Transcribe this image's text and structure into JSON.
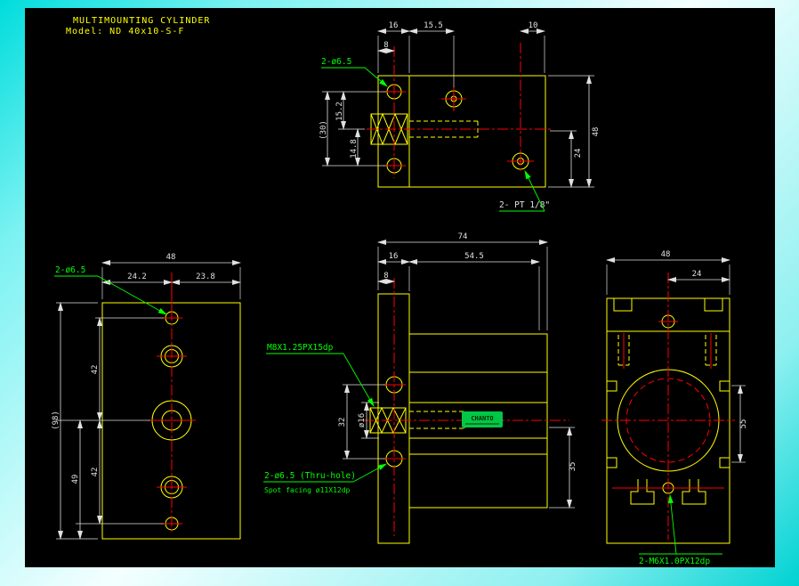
{
  "title": {
    "line1": "MULTIMOUNTING CYLINDER",
    "line2": "Model: ND 40x10-S-F"
  },
  "colors": {
    "canvas_background": "#000000",
    "geometry": "#ffff00",
    "centerline": "#ff0000",
    "dimension": "#e0e0e0",
    "annotation": "#00ff00",
    "title_text": "#ffff00",
    "logo_fill": "#00c846",
    "frame_cyan": "#00dcdc",
    "frame_white": "#f4ffff"
  },
  "top_view": {
    "dim_16": "16",
    "dim_15_5": "15.5",
    "dim_10": "10",
    "dim_8": "8",
    "dim_30_ref": "(30)",
    "dim_15_2": "15.2",
    "dim_14_8": "14.8",
    "dim_48": "48",
    "dim_24": "24",
    "label_holes": "2-ø6.5",
    "label_port": "2- PT 1/8\""
  },
  "front_view": {
    "dim_48": "48",
    "dim_24_2": "24.2",
    "dim_23_8": "23.8",
    "dim_42_upper": "42",
    "dim_42_lower": "42",
    "dim_49": "49",
    "dim_98_ref": "(98)",
    "label_holes": "2-ø6.5"
  },
  "side_view": {
    "dim_74": "74",
    "dim_16": "16",
    "dim_54_5": "54.5",
    "dim_8": "8",
    "dim_32": "32",
    "dim_dia16": "ø16",
    "dim_35": "35",
    "label_thread": "M8X1.25PX15dp",
    "label_thru_hole": "2-ø6.5 (Thru-hole)",
    "label_spot_facing": "Spot facing ø11X12dp",
    "logo_text": "CHANTO"
  },
  "end_view": {
    "dim_48": "48",
    "dim_24": "24",
    "dim_55": "55",
    "label_thread": "2-M6X1.0PX12dp"
  }
}
